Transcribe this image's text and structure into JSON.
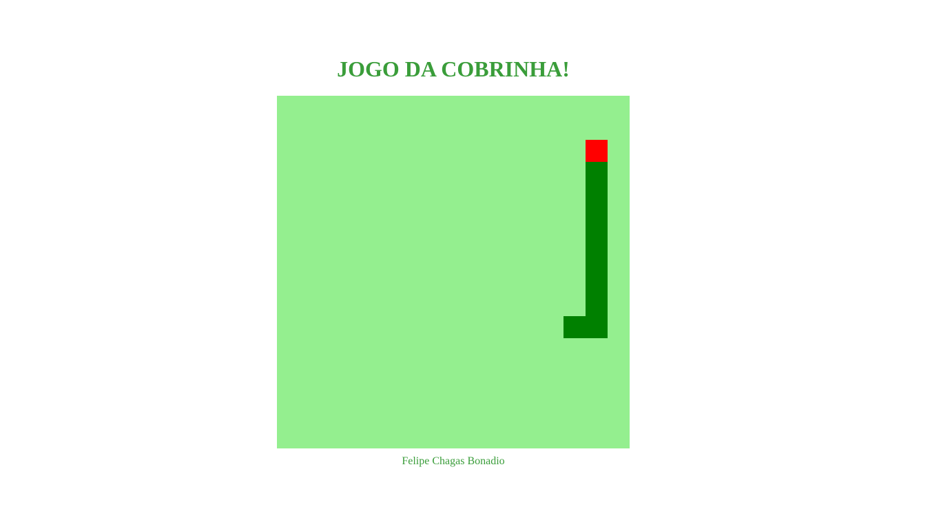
{
  "title": "JOGO DA COBRINHA!",
  "footer": "Felipe Chagas Bonadio",
  "colors": {
    "title_text": "#3a9d3a",
    "board_background": "#94ef8f",
    "snake": "#008000",
    "food": "#ff0000"
  },
  "board": {
    "columns": 16,
    "rows": 16,
    "food": {
      "col": 14,
      "row": 2
    },
    "snake": [
      {
        "col": 13,
        "row": 10
      },
      {
        "col": 14,
        "row": 10
      },
      {
        "col": 14,
        "row": 9
      },
      {
        "col": 14,
        "row": 8
      },
      {
        "col": 14,
        "row": 7
      },
      {
        "col": 14,
        "row": 6
      },
      {
        "col": 14,
        "row": 5
      },
      {
        "col": 14,
        "row": 4
      },
      {
        "col": 14,
        "row": 3
      }
    ]
  }
}
